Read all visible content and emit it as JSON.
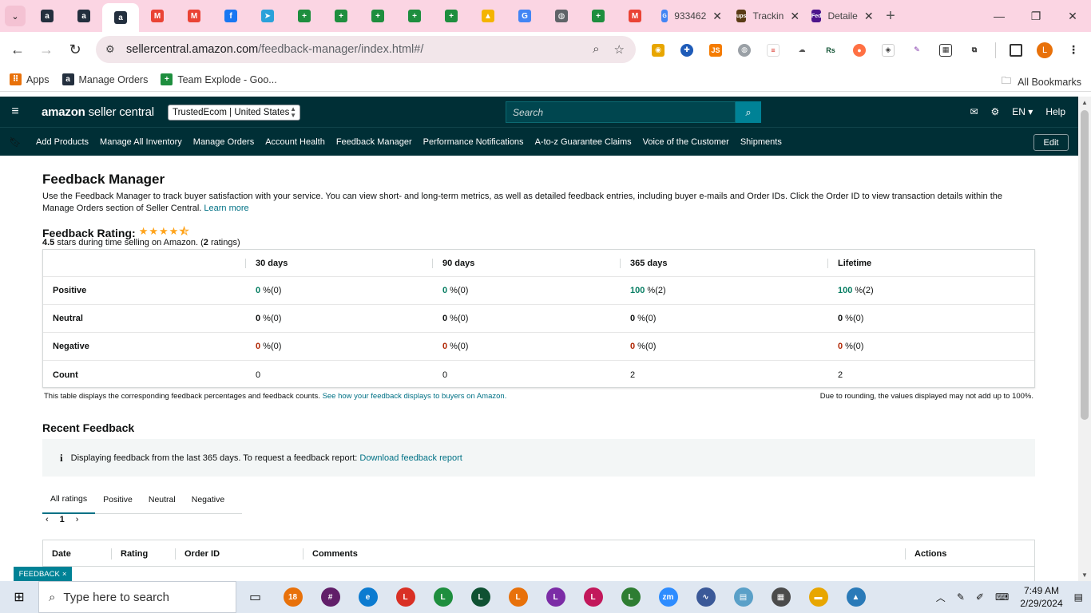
{
  "browser": {
    "tabs": [
      {
        "icon": "amazon-icon",
        "label": "a",
        "color": "#232f3e"
      },
      {
        "icon": "amazon-icon",
        "label": "a",
        "color": "#232f3e"
      },
      {
        "icon": "amazon-icon",
        "label": "a",
        "color": "#232f3e",
        "active": true
      },
      {
        "icon": "gmail-icon",
        "label": "M",
        "color": "#ea4335"
      },
      {
        "icon": "gmail-icon",
        "label": "M",
        "color": "#ea4335"
      },
      {
        "icon": "facebook-icon",
        "label": "f",
        "color": "#1877f2"
      },
      {
        "icon": "telegram-icon",
        "label": "➤",
        "color": "#2aa1da"
      },
      {
        "icon": "sheets-plus-icon",
        "label": "+",
        "color": "#1e8e3e"
      },
      {
        "icon": "sheets-plus-icon",
        "label": "+",
        "color": "#1e8e3e"
      },
      {
        "icon": "sheets-plus-icon",
        "label": "+",
        "color": "#1e8e3e"
      },
      {
        "icon": "sheets-plus-icon",
        "label": "+",
        "color": "#1e8e3e"
      },
      {
        "icon": "sheets-plus-icon",
        "label": "+",
        "color": "#1e8e3e"
      },
      {
        "icon": "google-drive-icon",
        "label": "▲",
        "color": "#f4b400"
      },
      {
        "icon": "google-icon",
        "label": "G",
        "color": "#4285f4"
      },
      {
        "icon": "globe-icon",
        "label": "◍",
        "color": "#5f6368"
      },
      {
        "icon": "sheets-plus-icon",
        "label": "+",
        "color": "#1e8e3e"
      },
      {
        "icon": "gmail-icon",
        "label": "M",
        "color": "#ea4335"
      }
    ],
    "wide_tabs": [
      {
        "icon": "google-icon",
        "label": "933462",
        "glyph": "G",
        "color": "#4285f4"
      },
      {
        "icon": "ups-icon",
        "label": "Trackin",
        "glyph": "ups",
        "color": "#5a3b16"
      },
      {
        "icon": "fedex-icon",
        "label": "Detaile",
        "glyph": "Fed",
        "color": "#4d148c"
      }
    ],
    "url_host": "sellercentral.amazon.com",
    "url_path": "/feedback-manager/index.html#/",
    "bookmarks": [
      {
        "icon": "apps-grid-icon",
        "label": "Apps",
        "glyph": "⠿",
        "color": "#e8710a"
      },
      {
        "icon": "amazon-icon",
        "label": "Manage Orders",
        "glyph": "a",
        "color": "#232f3e"
      },
      {
        "icon": "sheets-plus-icon",
        "label": "Team Explode - Goo...",
        "glyph": "+",
        "color": "#1e8e3e"
      }
    ],
    "all_bookmarks": "All Bookmarks",
    "profile_initial": "L"
  },
  "seller_central": {
    "logo_strong": "amazon",
    "logo_rest": " seller central",
    "store": "TrustedEcom | United States",
    "search_placeholder": "Search",
    "lang": "EN",
    "help": "Help",
    "nav": [
      "Add Products",
      "Manage All Inventory",
      "Manage Orders",
      "Account Health",
      "Feedback Manager",
      "Performance Notifications",
      "A-to-z Guarantee Claims",
      "Voice of the Customer",
      "Shipments"
    ],
    "edit": "Edit"
  },
  "page": {
    "title": "Feedback Manager",
    "intro": "Use the Feedback Manager to track buyer satisfaction with your service. You can view short- and long-term metrics, as well as detailed feedback entries, including buyer e-mails and Order IDs. Click the Order ID to view transaction details within the Manage Orders section of Seller Central.",
    "learn_more": "Learn more",
    "rating_label": "Feedback Rating:",
    "rating_value": 4.5,
    "rating_stars": "★★★★⯪",
    "rating_sub_bold": "4.5",
    "rating_sub_mid": " stars during time selling on Amazon. (",
    "rating_sub_count": "2",
    "rating_sub_end": " ratings)",
    "columns": [
      "30 days",
      "90 days",
      "365 days",
      "Lifetime"
    ],
    "rows": [
      {
        "label": "Positive",
        "vals": [
          {
            "n": "0",
            "p": " %(0)"
          },
          {
            "n": "0",
            "p": " %(0)"
          },
          {
            "n": "100",
            "p": " %(2)"
          },
          {
            "n": "100",
            "p": " %(2)"
          }
        ]
      },
      {
        "label": "Neutral",
        "vals": [
          {
            "n": "0",
            "p": " %(0)"
          },
          {
            "n": "0",
            "p": " %(0)"
          },
          {
            "n": "0",
            "p": " %(0)"
          },
          {
            "n": "0",
            "p": " %(0)"
          }
        ]
      },
      {
        "label": "Negative",
        "vals": [
          {
            "n": "0",
            "p": " %(0)"
          },
          {
            "n": "0",
            "p": " %(0)"
          },
          {
            "n": "0",
            "p": " %(0)"
          },
          {
            "n": "0",
            "p": " %(0)"
          }
        ]
      },
      {
        "label": "Count",
        "vals": [
          {
            "n": "0",
            "p": ""
          },
          {
            "n": "0",
            "p": ""
          },
          {
            "n": "2",
            "p": ""
          },
          {
            "n": "2",
            "p": ""
          }
        ]
      }
    ],
    "table_note": "This table displays the corresponding feedback percentages and feedback counts.",
    "table_note_link": "See how your feedback displays to buyers on Amazon.",
    "rounding_note": "Due to rounding, the values displayed may not add up to 100%.",
    "recent_title": "Recent Feedback",
    "info_text": "Displaying feedback from the last 365 days. To request a feedback report:",
    "info_link": "Download feedback report",
    "filter_tabs": [
      "All ratings",
      "Positive",
      "Neutral",
      "Negative"
    ],
    "page_num": "1",
    "fb_columns": [
      "Date",
      "Rating",
      "Order ID",
      "Comments",
      "Actions"
    ],
    "fb_badge": "FEEDBACK"
  },
  "taskbar": {
    "search_placeholder": "Type here to search",
    "time": "7:49 AM",
    "date": "2/29/2024",
    "apps": [
      {
        "icon": "outlook-badge-icon",
        "glyph": "18",
        "color": "#e8710a"
      },
      {
        "icon": "slack-icon",
        "glyph": "#",
        "color": "#611f69"
      },
      {
        "icon": "edge-icon",
        "glyph": "e",
        "color": "#0c7bd0"
      },
      {
        "icon": "chrome-icon",
        "glyph": "L",
        "color": "#d93025"
      },
      {
        "icon": "chrome-icon",
        "glyph": "L",
        "color": "#1e8e3e"
      },
      {
        "icon": "chrome-icon",
        "glyph": "L",
        "color": "#0f5132"
      },
      {
        "icon": "chrome-icon",
        "glyph": "L",
        "color": "#e8710a"
      },
      {
        "icon": "chrome-icon",
        "glyph": "L",
        "color": "#7b2ca6"
      },
      {
        "icon": "chrome-icon",
        "glyph": "L",
        "color": "#c2185b"
      },
      {
        "icon": "chrome-icon",
        "glyph": "L",
        "color": "#2e7d32"
      },
      {
        "icon": "zoom-icon",
        "glyph": "zm",
        "color": "#2d8cff"
      },
      {
        "icon": "chart-app-icon",
        "glyph": "∿",
        "color": "#3b5998"
      },
      {
        "icon": "notepad-icon",
        "glyph": "▤",
        "color": "#5aa0c8"
      },
      {
        "icon": "calculator-icon",
        "glyph": "▦",
        "color": "#4b4b4b"
      },
      {
        "icon": "file-explorer-icon",
        "glyph": "▬",
        "color": "#e8a600"
      },
      {
        "icon": "photos-icon",
        "glyph": "▲",
        "color": "#2a7ab8"
      }
    ]
  }
}
